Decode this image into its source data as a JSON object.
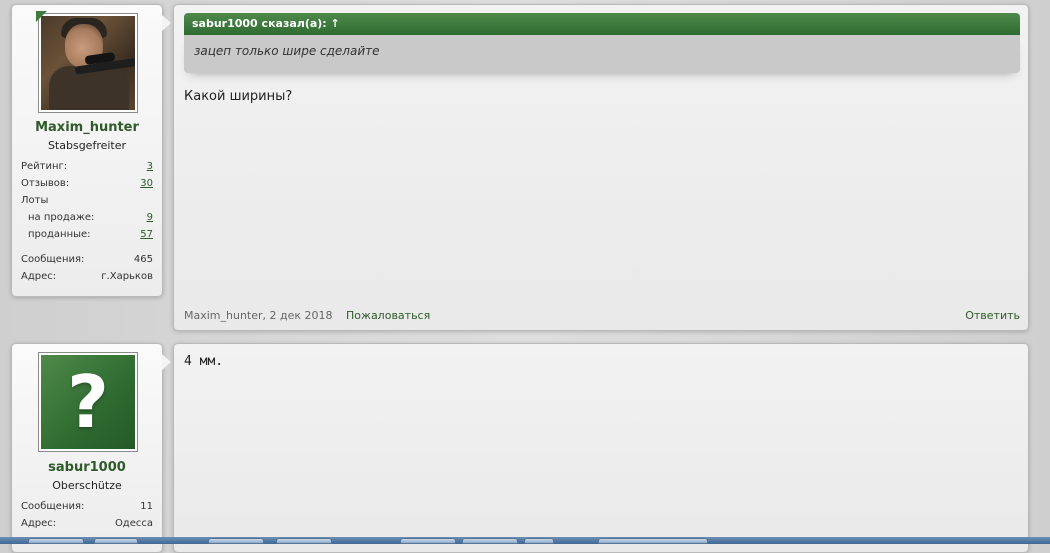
{
  "posts": [
    {
      "user": {
        "name": "Maxim_hunter",
        "title": "Stabsgefreiter",
        "avatar": "hunter-photo",
        "rating_label": "Рейтинг:",
        "rating_value": "3",
        "reviews_label": "Отзывов:",
        "reviews_value": "30",
        "lots_label": "Лоты",
        "on_sale_label": "на продаже:",
        "on_sale_value": "9",
        "sold_label": "проданные:",
        "sold_value": "57",
        "messages_label": "Сообщения:",
        "messages_value": "465",
        "address_label": "Адрес:",
        "address_value": "г.Харьков"
      },
      "quote_author": "sabur1000 сказал(а): ↑",
      "quote_text": "зацеп только шире сделайте",
      "message": "Какой ширины?",
      "footer_meta": "Maxim_hunter, 2 дек 2018",
      "report_label": "Пожаловаться",
      "reply_label": "Ответить"
    },
    {
      "user": {
        "name": "sabur1000",
        "title": "Oberschütze",
        "avatar": "question-mark",
        "messages_label": "Сообщения:",
        "messages_value": "11",
        "address_label": "Адрес:",
        "address_value": "Одесса"
      },
      "message": "4 мм."
    }
  ],
  "colors": {
    "accent_green": "#2f6a2f",
    "link_green": "#2f5a2a",
    "quote_bg": "#c9c9c9"
  }
}
